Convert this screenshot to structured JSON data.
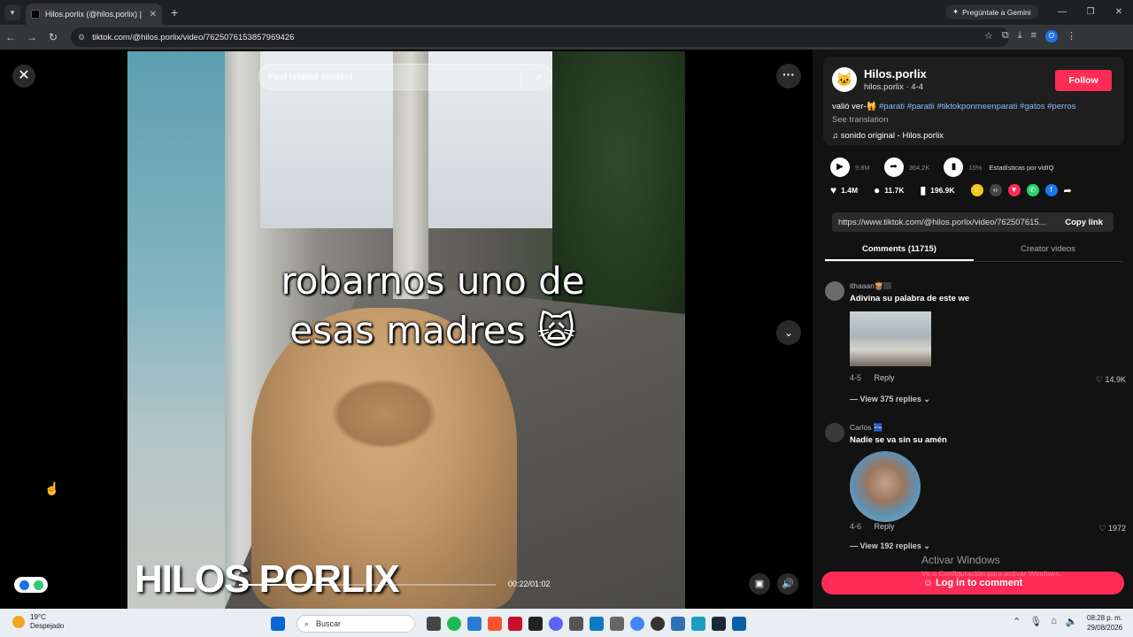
{
  "browser": {
    "tab_title": "Hilos.porlix (@hilos.porlix) | ...",
    "url": "tiktok.com/@hilos.porlix/video/7625076153857969426",
    "gemini_label": "Pregúntale a Gemini",
    "profile_initial": "O"
  },
  "video": {
    "search_placeholder": "Find related content",
    "caption_line1": "robarnos uno de",
    "caption_line2": "esas madres 🙀",
    "watermark": "HILOS PORLIX",
    "timecode": "00:22/01:02",
    "progress_fraction": 0.355
  },
  "panel": {
    "username": "Hilos.porlix",
    "subline": "hilos.porlix · 4-4",
    "follow_label": "Follow",
    "description": "valió ver-🙀",
    "hashtags": "#parati #paratii #tiktokponmeenparati #gatos #perros",
    "see_translation": "See translation",
    "music": "sonido original - Hilos.porlix",
    "plays": "9.8M",
    "shares_count": "364.2K",
    "percent": "15%",
    "vidiq_label": "Estadísticas por vidIQ",
    "likes": "1.4M",
    "comments": "11.7K",
    "saves": "196.9K",
    "link": "https://www.tiktok.com/@hilos.porlix/video/762507615...",
    "copy_link": "Copy link",
    "tab_comments": "Comments (11715)",
    "tab_creator": "Creator videos",
    "login_label": "Log in to comment"
  },
  "comments": [
    {
      "name": "ithaaan👸🏽🏽",
      "text": "Adivina su palabra de este we",
      "date": "4-5",
      "reply": "Reply",
      "likes": "14.9K",
      "replies": "View 375 replies"
    },
    {
      "name": "Carlos 🏧",
      "text": "Nadie se va sin su amén",
      "date": "4-6",
      "reply": "Reply",
      "likes": "1972",
      "replies": "View 192 replies"
    }
  ],
  "windows": {
    "activate_title": "Activar Windows",
    "activate_sub": "Ve a Configuración para activar Windows.",
    "weather_temp": "19°C",
    "weather_desc": "Despejado",
    "search": "Buscar",
    "time": "08:28 p. m.",
    "date": "29/08/2026"
  }
}
